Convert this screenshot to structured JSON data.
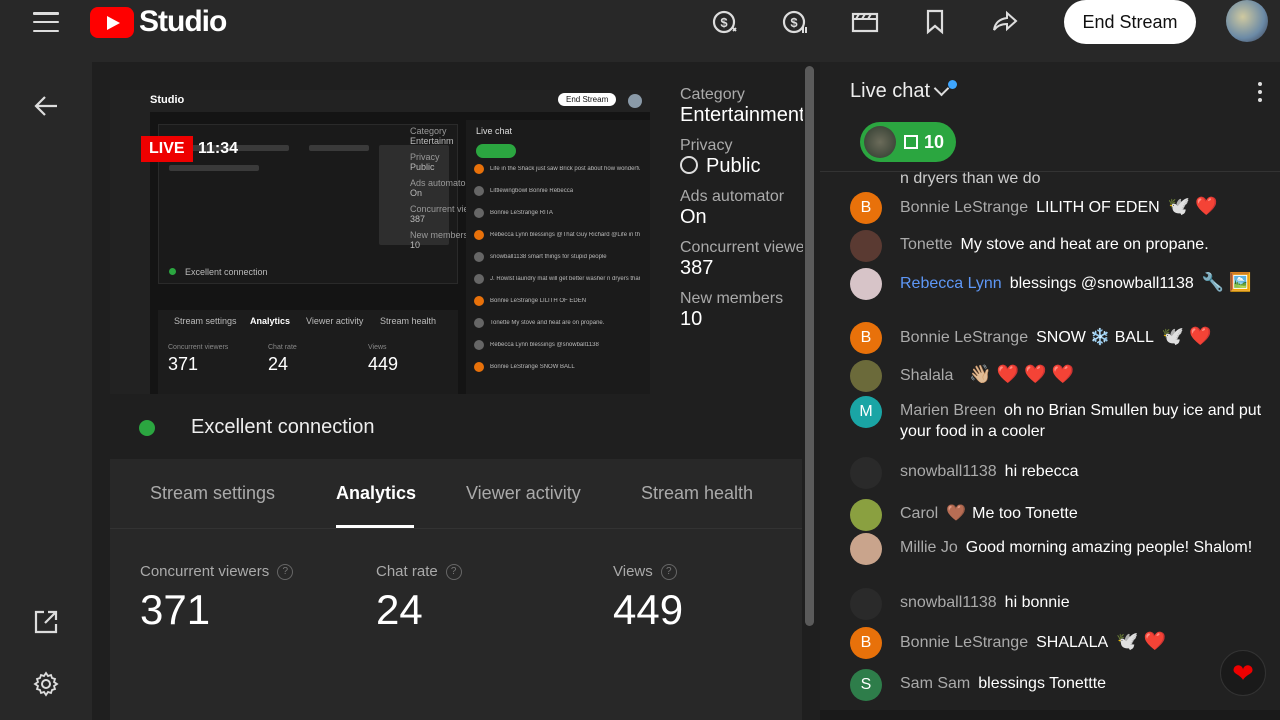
{
  "header": {
    "brand": "Studio",
    "end_stream_label": "End Stream",
    "icons": [
      "menu-icon",
      "youtube-logo",
      "super-chat-icon",
      "super-thanks-icon",
      "clapperboard-icon",
      "bookmark-icon",
      "share-icon",
      "avatar"
    ]
  },
  "left_rail": {
    "icons": [
      "back-arrow-icon",
      "external-link-icon",
      "settings-icon"
    ]
  },
  "preview": {
    "live_label": "LIVE",
    "elapsed": "11:34",
    "mini": {
      "studio": "Studio",
      "end_stream": "End Stream",
      "live_chat": "Live chat",
      "category": "Category",
      "entertainment": "Entertainm",
      "privacy": "Privacy",
      "public": "Public",
      "ads": "Ads automator",
      "on": "On",
      "concurrent": "Concurrent viewers",
      "concurrent_value": "387",
      "new_members": "New members",
      "new_members_value": "10",
      "connection": "Excellent connection",
      "tabs": [
        "Stream settings",
        "Analytics",
        "Viewer activity",
        "Stream health"
      ],
      "stats": [
        {
          "label": "Concurrent viewers",
          "value": "371"
        },
        {
          "label": "Chat rate",
          "value": "24"
        },
        {
          "label": "Views",
          "value": "449"
        }
      ],
      "chat_lines": [
        "Life in the Shack  just saw Brick post about how wonderful gabbo livestorm was lol comments couldn't praise him enough, peeps are nuts",
        "Littlewingbowl  Bonnie Rebecca",
        "Bonnie LeStrange  RITA",
        "Rebecca Lynn  blessings @That Guy Richard @Life in the Shack",
        "snowball1138  smart things for stupid people",
        "J. Rowlst  laundry mat will get better washer n dryers than we do",
        "Bonnie LeStrange  LILITH OF EDEN",
        "Tonette  My stove and heat are on propane.",
        "Rebecca Lynn  blessings @snowball1138",
        "Bonnie LeStrange  SNOW BALL"
      ]
    }
  },
  "details": {
    "category_label": "Category",
    "category_value": "Entertainment",
    "privacy_label": "Privacy",
    "privacy_value": "Public",
    "ads_label": "Ads automator",
    "ads_value": "On",
    "concurrent_label": "Concurrent viewers",
    "concurrent_value": "387",
    "new_members_label": "New members",
    "new_members_value": "10"
  },
  "connection": {
    "status": "Excellent connection",
    "color": "#2ba640"
  },
  "tabs": [
    {
      "label": "Stream settings",
      "active": false
    },
    {
      "label": "Analytics",
      "active": true
    },
    {
      "label": "Viewer activity",
      "active": false
    },
    {
      "label": "Stream health",
      "active": false
    }
  ],
  "analytics": [
    {
      "label": "Concurrent viewers",
      "value": "371"
    },
    {
      "label": "Chat rate",
      "value": "24"
    },
    {
      "label": "Views",
      "value": "449"
    }
  ],
  "chat": {
    "title": "Live chat",
    "gift_count": "10",
    "partial_top": "n dryers than we do",
    "messages": [
      {
        "author": "Bonnie LeStrange",
        "text": "LILITH OF EDEN",
        "emoji": "🕊️ ❤️",
        "avatar_letter": "B",
        "avatar_color": "#e8710a"
      },
      {
        "author": "Tonette",
        "text": "My stove and heat are on propane.",
        "emoji": "",
        "avatar_letter": "",
        "avatar_color": "#5a3a32"
      },
      {
        "author": "Rebecca Lynn",
        "text": "blessings @snowball1138",
        "emoji": "🔧 🖼️",
        "avatar_letter": "",
        "avatar_color": "#d7c4c8",
        "author_color": "#5e97f6"
      },
      {
        "author": "Bonnie LeStrange",
        "text": "SNOW ❄️ BALL",
        "emoji": "🕊️ ❤️",
        "avatar_letter": "B",
        "avatar_color": "#e8710a"
      },
      {
        "author": "Shalala",
        "text": "",
        "emoji": "👋🏼 ❤️ ❤️ ❤️",
        "avatar_letter": "",
        "avatar_color": "#6b6a3a"
      },
      {
        "author": "Marien Breen",
        "text": "oh no Brian Smullen buy ice and put your food in a cooler",
        "emoji": "",
        "avatar_letter": "M",
        "avatar_color": "#1aa5a5"
      },
      {
        "author": "snowball1138",
        "text": "hi rebecca",
        "emoji": "",
        "avatar_letter": "",
        "avatar_color": "#2a2a2a"
      },
      {
        "author": "Carol",
        "text": "Me too Tonette",
        "emoji": "",
        "avatar_letter": "",
        "avatar_color": "#8aa040",
        "author_badge": "🤎"
      },
      {
        "author": "Millie Jo",
        "text": "Good morning amazing people! Shalom!",
        "emoji": "",
        "avatar_letter": "",
        "avatar_color": "#c9a48c"
      },
      {
        "author": "snowball1138",
        "text": "hi bonnie",
        "emoji": "",
        "avatar_letter": "",
        "avatar_color": "#2a2a2a"
      },
      {
        "author": "Bonnie LeStrange",
        "text": "SHALALA",
        "emoji": "🕊️ ❤️",
        "avatar_letter": "B",
        "avatar_color": "#e8710a"
      },
      {
        "author": "Sam Sam",
        "text": "blessings Tonettte",
        "emoji": "",
        "avatar_letter": "S",
        "avatar_color": "#2e7d4a"
      }
    ],
    "heart_reaction": "❤"
  },
  "colors": {
    "live_red": "#ee0000",
    "accent_green": "#2ba640",
    "youtube_red": "#ff0000",
    "link_blue": "#5e97f6"
  }
}
